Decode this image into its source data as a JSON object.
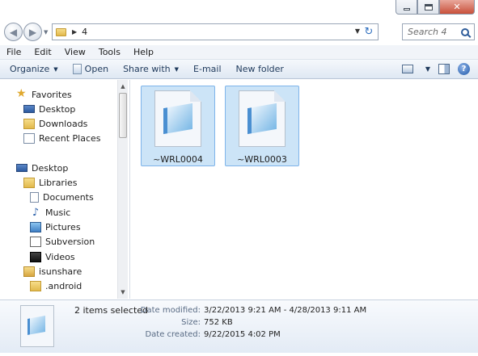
{
  "address": {
    "path_segment": "4"
  },
  "search": {
    "placeholder": "Search 4"
  },
  "menu": [
    "File",
    "Edit",
    "View",
    "Tools",
    "Help"
  ],
  "toolbar": {
    "organize": "Organize",
    "open": "Open",
    "share_with": "Share with",
    "email": "E-mail",
    "new_folder": "New folder"
  },
  "nav": {
    "favorites": "Favorites",
    "desktop_fav": "Desktop",
    "downloads": "Downloads",
    "recent": "Recent Places",
    "desktop": "Desktop",
    "libraries": "Libraries",
    "documents": "Documents",
    "music": "Music",
    "pictures": "Pictures",
    "subversion": "Subversion",
    "videos": "Videos",
    "isunshare": "isunshare",
    "android": ".android"
  },
  "files": [
    {
      "name": "~WRL0004"
    },
    {
      "name": "~WRL0003"
    }
  ],
  "details": {
    "selected": "2 items selected",
    "modified_label": "Date modified:",
    "modified_value": "3/22/2013 9:21 AM - 4/28/2013 9:11 AM",
    "size_label": "Size:",
    "size_value": "752 KB",
    "created_label": "Date created:",
    "created_value": "9/22/2015 4:02 PM"
  },
  "icons": [
    "back-icon",
    "forward-icon",
    "folder-icon",
    "refresh-icon",
    "search-icon",
    "open-icon",
    "views-icon",
    "preview-pane-icon",
    "help-icon",
    "star-icon",
    "desktop-icon",
    "downloads-icon",
    "recent-places-icon",
    "libraries-icon",
    "documents-icon",
    "music-icon",
    "pictures-icon",
    "subversion-icon",
    "videos-icon",
    "user-folder-icon",
    "file-icon"
  ],
  "colors": {
    "selection_fill": "#cce4f7",
    "selection_border": "#7eb4ea",
    "toolbar_text": "#1e395b"
  }
}
